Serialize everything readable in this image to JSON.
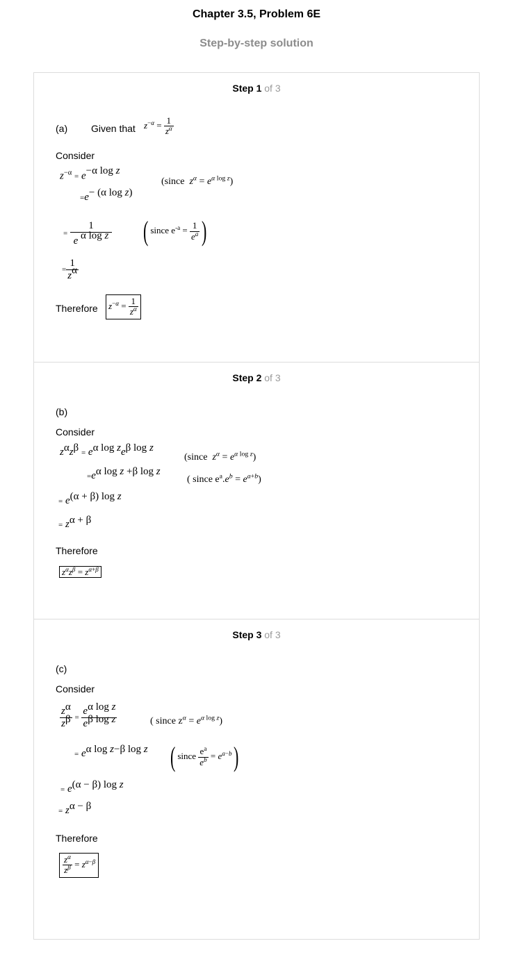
{
  "header": {
    "title": "Chapter 3.5, Problem 6E",
    "subtitle": "Step-by-step solution"
  },
  "steps": [
    {
      "label": "Step 1",
      "of": "of 3",
      "part": "(a)",
      "given": "Given that",
      "consider": "Consider",
      "therefore": "Therefore",
      "since1": "(since",
      "since2": "since e",
      "eq_given": "z^{-α} = 1/z^α",
      "eq_lines": [
        "z^{-α} = e^{-α log z}",
        "= e^{-(α log z)}",
        "= 1 / e^{α log z}",
        "= 1 / z^α"
      ],
      "result": "z^{-α} = 1/z^α"
    },
    {
      "label": "Step 2",
      "of": "of 3",
      "part": "(b)",
      "consider": "Consider",
      "therefore": "Therefore",
      "since1": "(since",
      "since2": "( since e",
      "eq_lines": [
        "z^α z^β = e^{α log z} e^{β log z}",
        "= e^{α log z + β log z}",
        "= e^{(α+β) log z}",
        "= z^{α+β}"
      ],
      "result": "z^α z^β = z^{α+β}"
    },
    {
      "label": "Step 3",
      "of": "of 3",
      "part": "(c)",
      "consider": "Consider",
      "therefore": "Therefore",
      "since1": "( since z",
      "since2": "since",
      "eq_lines": [
        "z^α / z^β = e^{α log z} / e^{β log z}",
        "= e^{α log z − β log z}",
        "= e^{(α−β) log z}",
        "= z^{α−β}"
      ],
      "result": "z^α / z^β = z^{α−β}"
    }
  ]
}
